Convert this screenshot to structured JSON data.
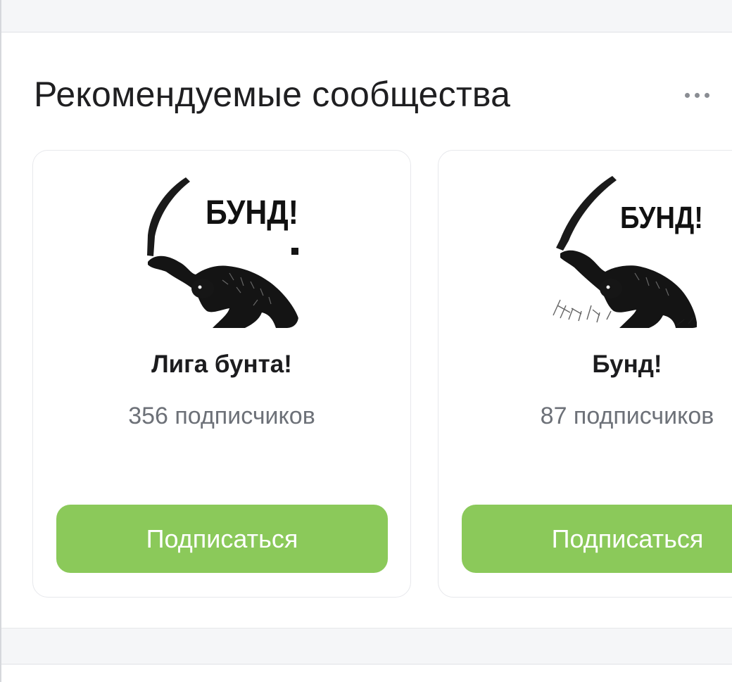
{
  "section": {
    "title": "Рекомендуемые сообщества",
    "more_icon": "ellipsis-horizontal-icon"
  },
  "communities": [
    {
      "name": "Лига бунта!",
      "subscribers": "356 подписчиков",
      "avatar_text": "БУНД!",
      "button_label": "Подписаться"
    },
    {
      "name": "Бунд!",
      "subscribers": "87 подписчиков",
      "avatar_text": "БУНД!",
      "button_label": "Подписаться"
    }
  ],
  "colors": {
    "button": "#8bc95a",
    "title_text": "#1f1f21",
    "muted_text": "#6d7178",
    "page_background": "#f5f6f8"
  }
}
